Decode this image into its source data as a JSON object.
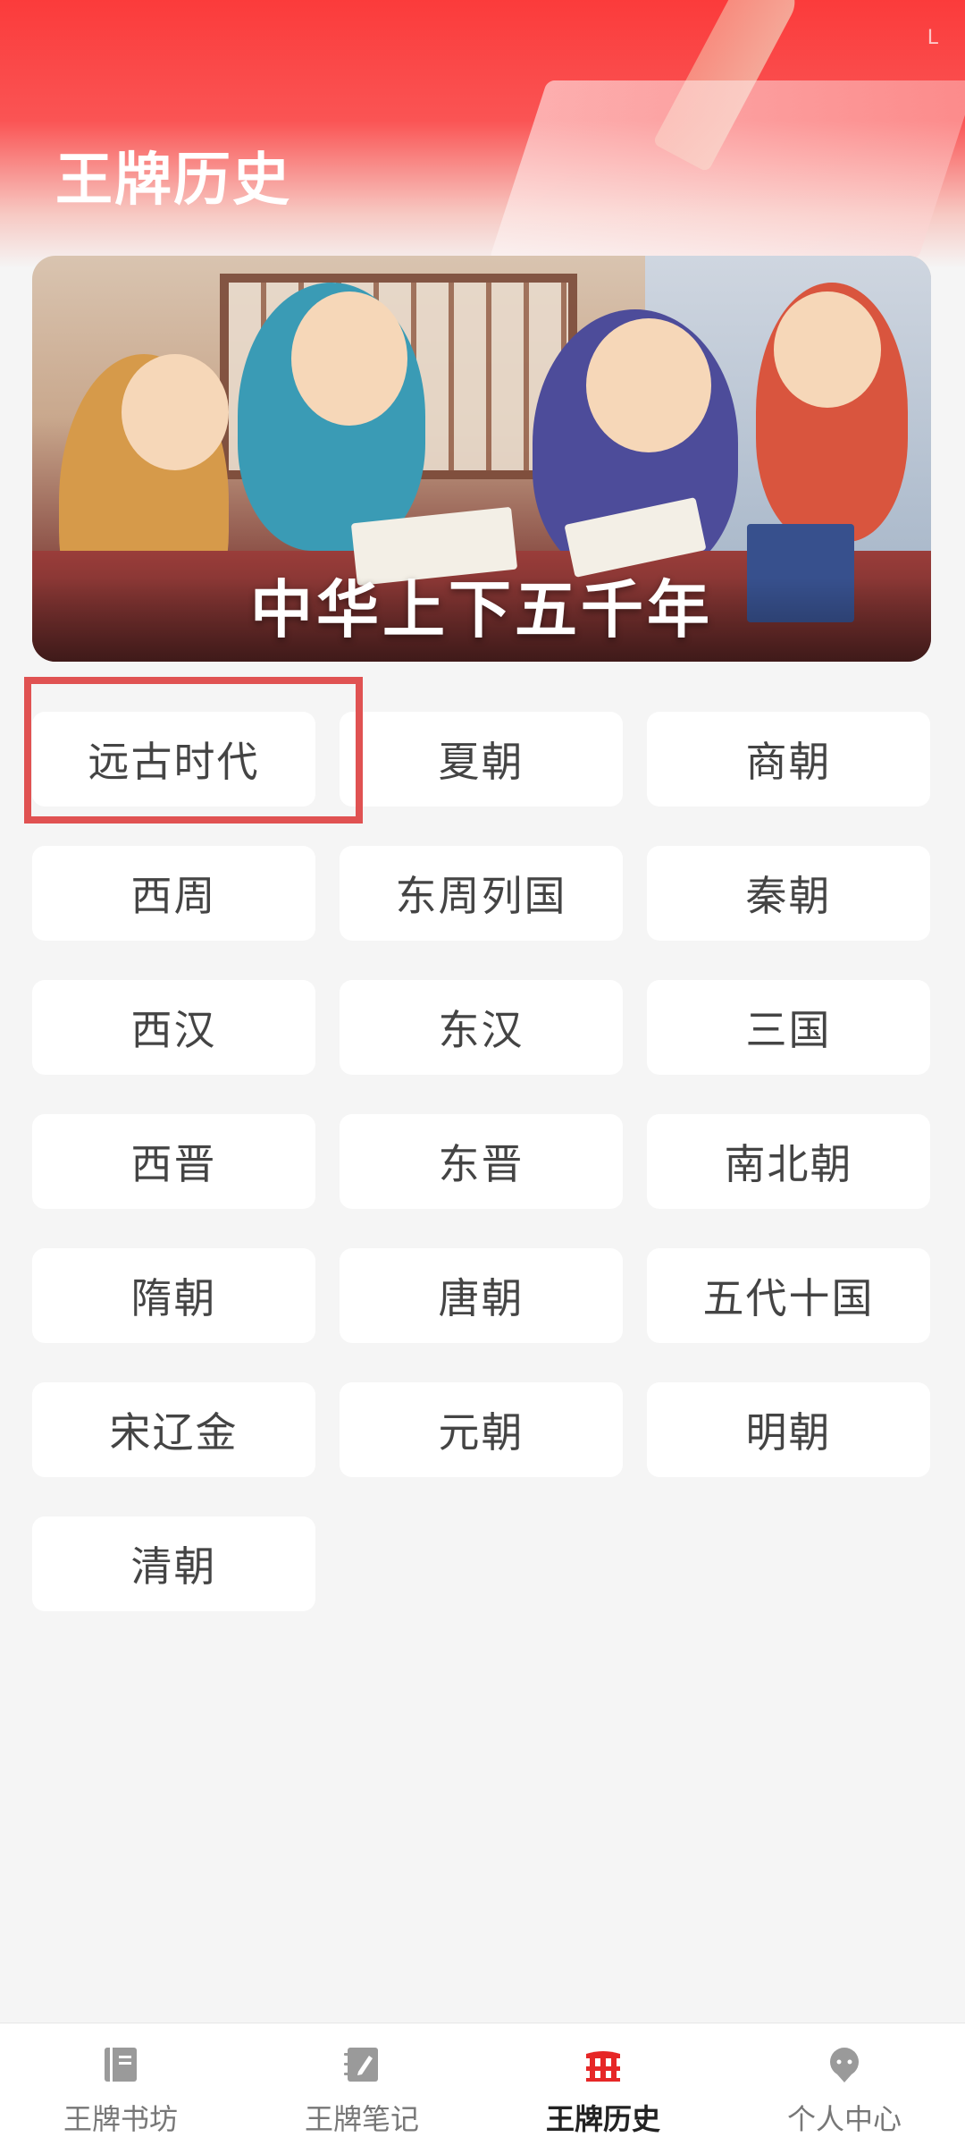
{
  "header": {
    "title": "王牌历史",
    "corner_mark": "L"
  },
  "banner": {
    "caption": "中华上下五千年"
  },
  "eras": [
    {
      "label": "远古时代"
    },
    {
      "label": "夏朝"
    },
    {
      "label": "商朝"
    },
    {
      "label": "西周"
    },
    {
      "label": "东周列国"
    },
    {
      "label": "秦朝"
    },
    {
      "label": "西汉"
    },
    {
      "label": "东汉"
    },
    {
      "label": "三国"
    },
    {
      "label": "西晋"
    },
    {
      "label": "东晋"
    },
    {
      "label": "南北朝"
    },
    {
      "label": "隋朝"
    },
    {
      "label": "唐朝"
    },
    {
      "label": "五代十国"
    },
    {
      "label": "宋辽金"
    },
    {
      "label": "元朝"
    },
    {
      "label": "明朝"
    },
    {
      "label": "清朝"
    }
  ],
  "tabbar": {
    "items": [
      {
        "label": "王牌书坊",
        "icon": "book-icon",
        "active": false
      },
      {
        "label": "王牌笔记",
        "icon": "notebook-pen-icon",
        "active": false
      },
      {
        "label": "王牌历史",
        "icon": "history-gate-icon",
        "active": true
      },
      {
        "label": "个人中心",
        "icon": "profile-icon",
        "active": false
      }
    ]
  },
  "colors": {
    "brand_red": "#fb3b3b",
    "highlight_box": "#e05252",
    "active_icon": "#e62727",
    "inactive_icon": "#9a9a9a"
  }
}
